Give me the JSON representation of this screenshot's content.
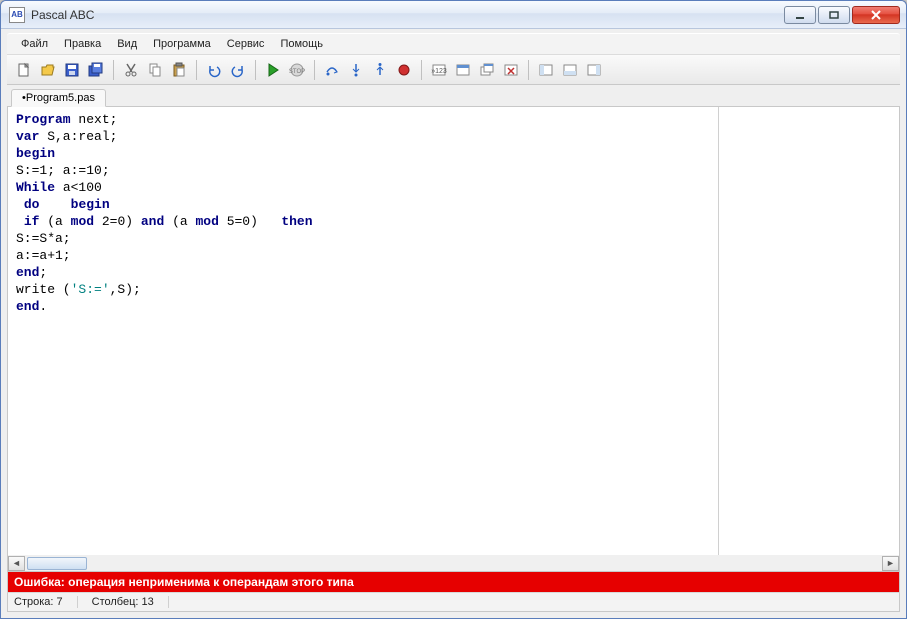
{
  "window": {
    "title": "Pascal ABC",
    "icon_text": "AB"
  },
  "menu": {
    "items": [
      "Файл",
      "Правка",
      "Вид",
      "Программа",
      "Сервис",
      "Помощь"
    ]
  },
  "toolbar": {
    "icons": [
      "new-file-icon",
      "open-file-icon",
      "save-icon",
      "save-all-icon",
      "sep",
      "cut-icon",
      "copy-icon",
      "paste-icon",
      "sep",
      "undo-icon",
      "redo-icon",
      "sep",
      "run-icon",
      "stop-icon",
      "sep",
      "step-over-icon",
      "step-into-icon",
      "step-out-icon",
      "breakpoint-icon",
      "sep",
      "goto-line-icon",
      "window-icon",
      "windows-icon",
      "close-window-icon",
      "sep",
      "view1-icon",
      "view2-icon",
      "view3-icon"
    ]
  },
  "tabs": {
    "active": "•Program5.pas"
  },
  "code": {
    "lines": [
      [
        {
          "t": "Program",
          "c": "kw"
        },
        {
          "t": " next;"
        }
      ],
      [
        {
          "t": "var",
          "c": "kw"
        },
        {
          "t": " S,a:real;"
        }
      ],
      [
        {
          "t": "begin",
          "c": "kw"
        }
      ],
      [
        {
          "t": "S:=1; a:=10;"
        }
      ],
      [
        {
          "t": "While",
          "c": "kw"
        },
        {
          "t": " a<100"
        }
      ],
      [
        {
          "t": " "
        },
        {
          "t": "do",
          "c": "kw"
        },
        {
          "t": "    "
        },
        {
          "t": "begin",
          "c": "kw"
        }
      ],
      [
        {
          "t": " "
        },
        {
          "t": "if",
          "c": "kw"
        },
        {
          "t": " (a "
        },
        {
          "t": "mod",
          "c": "kw"
        },
        {
          "t": " 2=0) "
        },
        {
          "t": "and",
          "c": "kw"
        },
        {
          "t": " (a "
        },
        {
          "t": "mod",
          "c": "kw"
        },
        {
          "t": " 5=0)   "
        },
        {
          "t": "then",
          "c": "kw"
        }
      ],
      [
        {
          "t": "S:=S*a;"
        }
      ],
      [
        {
          "t": "a:=a+1;"
        }
      ],
      [
        {
          "t": "end",
          "c": "kw"
        },
        {
          "t": ";"
        }
      ],
      [
        {
          "t": "write ("
        },
        {
          "t": "'S:='",
          "c": "str"
        },
        {
          "t": ",S);"
        }
      ],
      [
        {
          "t": "end",
          "c": "kw"
        },
        {
          "t": "."
        }
      ]
    ]
  },
  "error": {
    "text": "Ошибка: операция неприменима к операндам этого типа"
  },
  "status": {
    "line_label": "Строка:",
    "line_value": "7",
    "col_label": "Столбец:",
    "col_value": "13"
  }
}
